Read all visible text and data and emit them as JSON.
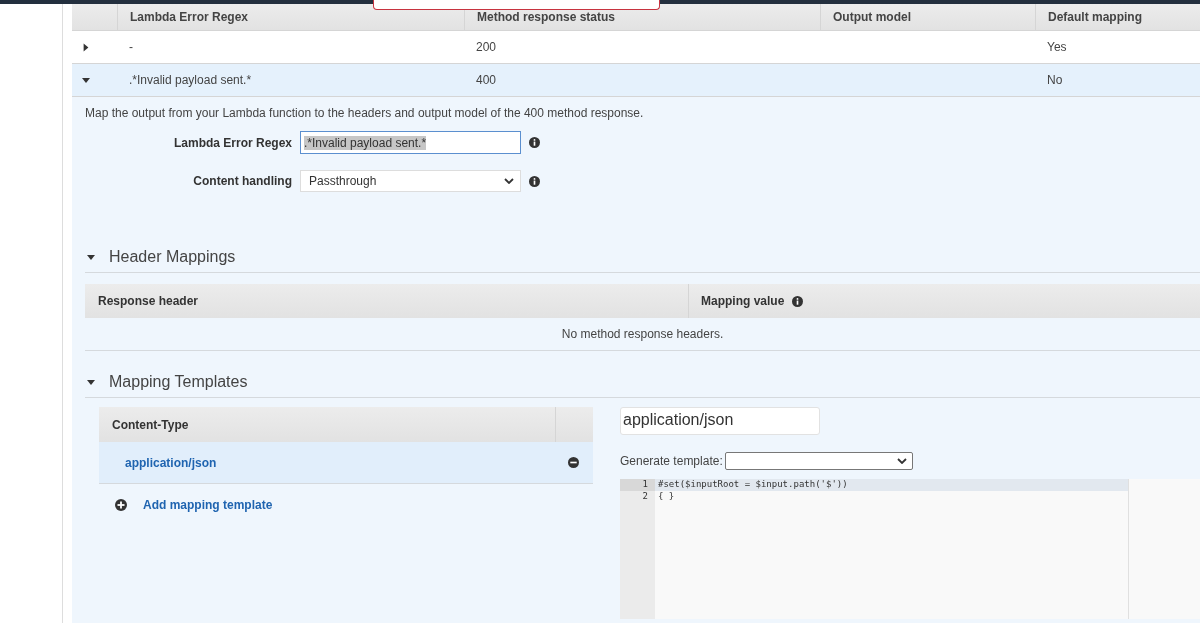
{
  "responses_table": {
    "columns": [
      "Lambda Error Regex",
      "Method response status",
      "Output model",
      "Default mapping"
    ],
    "rows": [
      {
        "expanded": false,
        "selected": false,
        "cells": [
          "-",
          "200",
          "",
          "Yes"
        ]
      },
      {
        "expanded": true,
        "selected": true,
        "cells": [
          ".*Invalid payload sent.*",
          "400",
          "",
          "No"
        ]
      }
    ]
  },
  "detail": {
    "description": "Map the output from your Lambda function to the headers and output model of the 400 method response.",
    "fields": [
      {
        "kind": "text",
        "label": "Lambda Error Regex",
        "value": ".*Invalid payload sent.*"
      },
      {
        "kind": "select",
        "label": "Content handling",
        "value": "Passthrough"
      }
    ]
  },
  "header_mappings": {
    "title": "Header Mappings",
    "expanded": true,
    "columns": [
      "Response header",
      "Mapping value"
    ],
    "empty_message": "No method response headers."
  },
  "mapping_templates": {
    "title": "Mapping Templates",
    "expanded": true,
    "column": "Content-Type",
    "items": [
      {
        "label": "application/json",
        "selected": true
      }
    ],
    "add_label": "Add mapping template",
    "content_type_value": "application/json",
    "generate_label": "Generate template:",
    "code_lines": [
      {
        "number": "1",
        "text": "#set($inputRoot = $input.path('$'))"
      },
      {
        "number": "2",
        "text": "{ }"
      }
    ]
  }
}
